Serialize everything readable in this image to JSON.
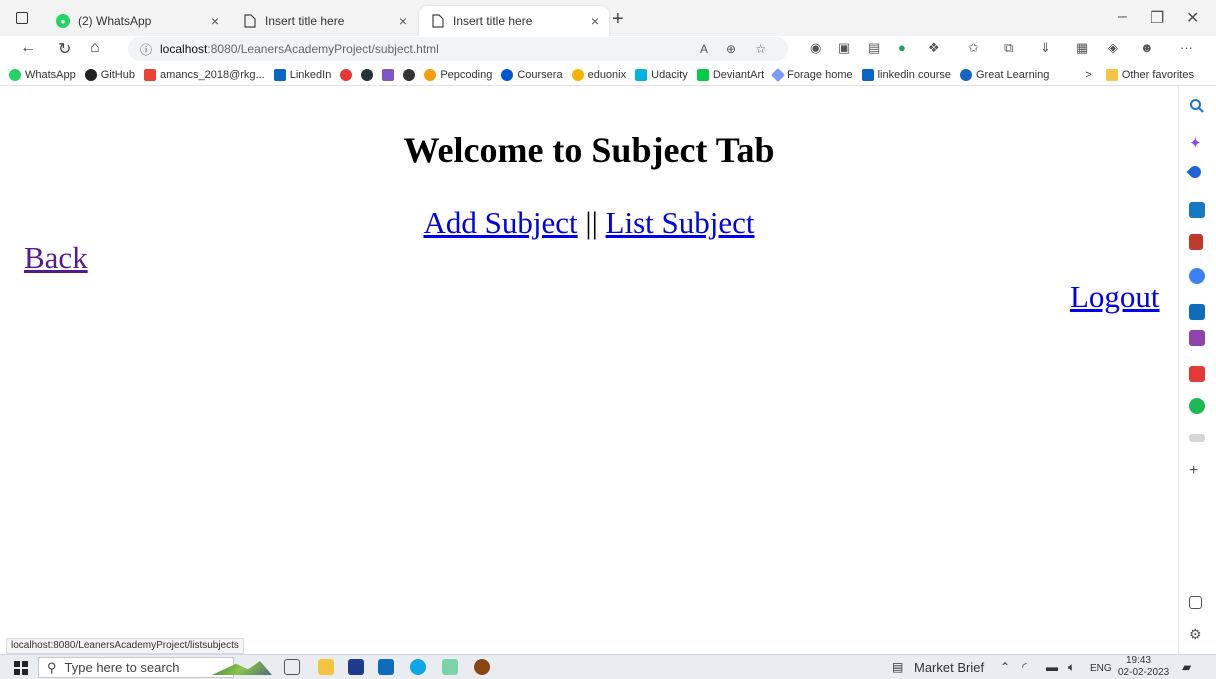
{
  "browser": {
    "tabs": [
      {
        "title": "(2) WhatsApp",
        "icon": "whatsapp-icon",
        "close": "×"
      },
      {
        "title": "Insert title here",
        "icon": "page-icon",
        "close": "×"
      },
      {
        "title": "Insert title here",
        "icon": "page-icon",
        "close": "×"
      }
    ],
    "new_tab": "+",
    "url_host": "localhost",
    "url_path": ":8080/LeanersAcademyProject/subject.html",
    "menu": "···",
    "bookmarks": [
      {
        "label": "WhatsApp",
        "color": "#25d366"
      },
      {
        "label": "GitHub",
        "color": "#222222"
      },
      {
        "label": "amancs_2018@rkg...",
        "color": "#ea4335"
      },
      {
        "label": "LinkedIn",
        "color": "#0a66c2"
      },
      {
        "label": "Pepcoding",
        "color": "#f59e0b"
      },
      {
        "label": "Coursera",
        "color": "#0056d2"
      },
      {
        "label": "eduonix",
        "color": "#f4b400"
      },
      {
        "label": "Udacity",
        "color": "#02b3e4"
      },
      {
        "label": "DeviantArt",
        "color": "#05cc47"
      },
      {
        "label": "Forage home",
        "color": "#7c9cf5"
      },
      {
        "label": "linkedin course",
        "color": "#0a66c2"
      },
      {
        "label": "Great Learning",
        "color": "#1565c0"
      }
    ],
    "bookmarks_more": ">",
    "other_favorites": "Other favorites",
    "status_url": "localhost:8080/LeanersAcademyProject/listsubjects"
  },
  "page": {
    "heading": "Welcome to Subject Tab",
    "add_subject": "Add Subject",
    "separator": "||",
    "list_subject": "List Subject",
    "back": "Back",
    "logout": "Logout"
  },
  "taskbar": {
    "search_placeholder": "Type here to search",
    "market_brief": "Market Brief",
    "language": "ENG",
    "time": "19:43",
    "date": "02-02-2023"
  }
}
